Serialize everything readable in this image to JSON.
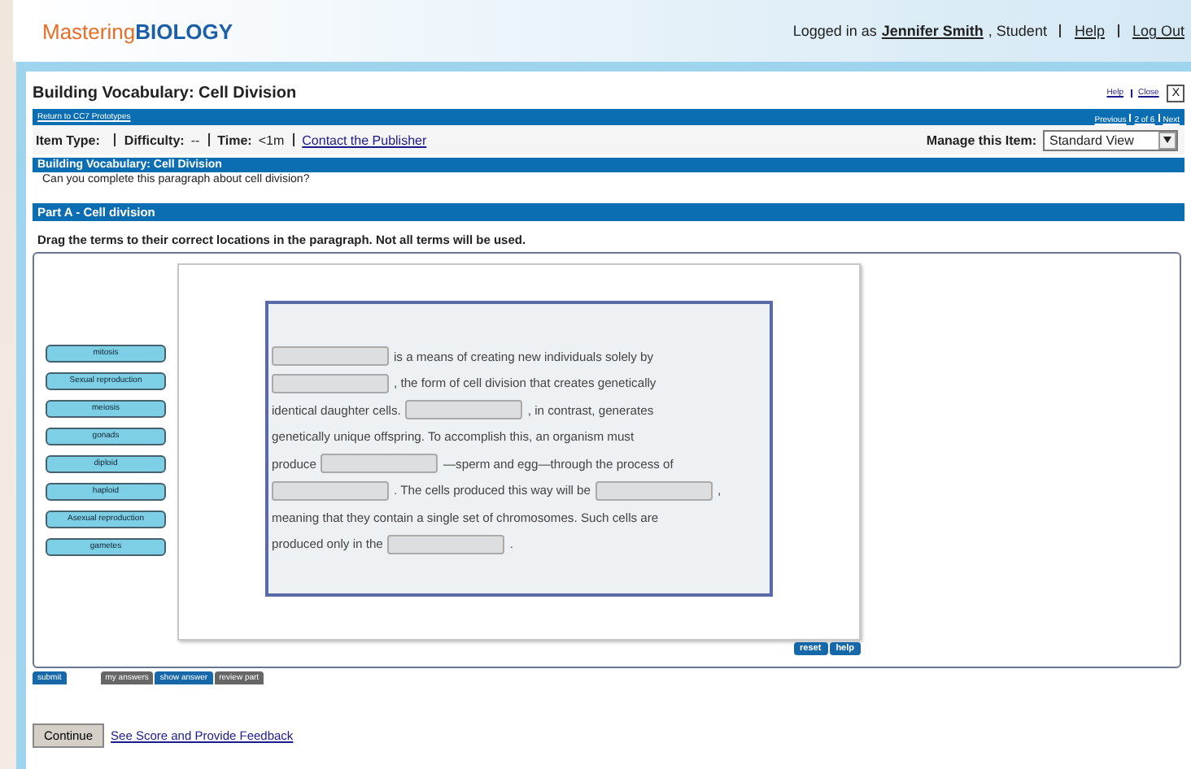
{
  "header": {
    "logo_part1": "Mastering",
    "logo_part2": "BIOLOGY",
    "logged_in_prefix": "Logged in as",
    "user": "Jennifer Smith",
    "role": ", Student",
    "links": [
      "Help",
      "Log Out"
    ]
  },
  "title_bar": {
    "title": "Building Vocabulary: Cell Division",
    "links": [
      "Help",
      "Close"
    ],
    "close_glyph": "X"
  },
  "nav_bar": {
    "back_link": "Return to CC7 Prototypes",
    "pager": [
      "Previous",
      "2 of 6",
      "Next"
    ]
  },
  "item_info": {
    "item_type_label": "Item Type:",
    "difficulty_label": "Difficulty:",
    "difficulty": "--",
    "time_label": "Time:",
    "time": "<1m",
    "contact_link": "Contact the Publisher",
    "manage_label": "Manage this Item:",
    "manage_value": "Standard View"
  },
  "intro": {
    "heading": "Building Vocabulary: Cell Division",
    "question": "Can you complete this paragraph about cell division?"
  },
  "part": {
    "heading": "Part A - Cell division",
    "instructions": "Drag the terms to their correct locations in the paragraph. Not all terms will be used."
  },
  "terms": [
    "mitosis",
    "Sexual reproduction",
    "meiosis",
    "gonads",
    "diploid",
    "haploid",
    "Asexual reproduction",
    "gametes"
  ],
  "paragraph_lines": [
    [
      {
        "kind": "blank"
      },
      {
        "kind": "text",
        "text": "is a means of creating new individuals solely by"
      }
    ],
    [
      {
        "kind": "blank"
      },
      {
        "kind": "text",
        "text": ", the form of cell division that creates genetically"
      }
    ],
    [
      {
        "kind": "text",
        "text": "identical daughter cells."
      },
      {
        "kind": "blank"
      },
      {
        "kind": "text",
        "text": ", in contrast, generates"
      }
    ],
    [
      {
        "kind": "text",
        "text": "genetically unique offspring. To accomplish this, an organism must"
      }
    ],
    [
      {
        "kind": "text",
        "text": "produce"
      },
      {
        "kind": "blank"
      },
      {
        "kind": "text",
        "text": "—sperm and egg—through the process of"
      }
    ],
    [
      {
        "kind": "blank"
      },
      {
        "kind": "text",
        "text": ". The cells produced this way will be"
      },
      {
        "kind": "blank"
      },
      {
        "kind": "text",
        "text": ","
      }
    ],
    [
      {
        "kind": "text",
        "text": "meaning that they contain a single set of chromosomes. Such cells are"
      }
    ],
    [
      {
        "kind": "text",
        "text": "produced only in the"
      },
      {
        "kind": "blank"
      },
      {
        "kind": "text",
        "text": "."
      }
    ]
  ],
  "tool_buttons": [
    "reset",
    "help"
  ],
  "answer_tabs": [
    {
      "label": "submit",
      "kind": "blue"
    },
    {
      "label": "my answers",
      "kind": "gray"
    },
    {
      "label": "show answer",
      "kind": "blue"
    },
    {
      "label": "review part",
      "kind": "gray"
    }
  ],
  "footer": {
    "continue": "Continue",
    "feedback_link": "See Score and Provide Feedback"
  }
}
